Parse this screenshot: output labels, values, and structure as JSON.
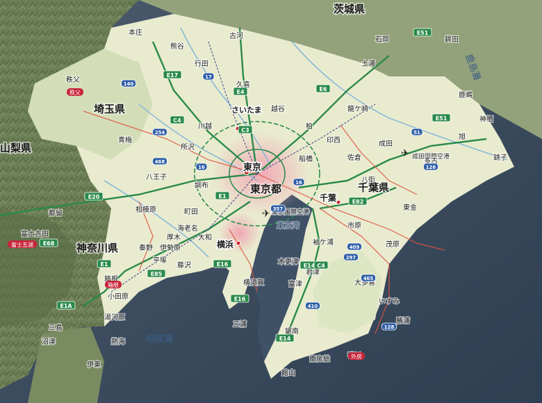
{
  "prefectures": {
    "ibaraki": "茨城県",
    "saitama": "埼玉県",
    "chiba": "千葉県",
    "tokyo": "東京都",
    "kanagawa": "神奈川県",
    "yamanashi": "山梨県"
  },
  "capitals": {
    "tokyo": "東京",
    "saitama": "さいたま",
    "yokohama": "横浜",
    "chiba": "千葉"
  },
  "airports": {
    "narita": "成田国際空港",
    "haneda": "東京国際空港"
  },
  "water_bodies": {
    "sagami_bay": "相模灘",
    "kashima_sea": "鹿島灘",
    "tokyo_bay": "東京湾"
  },
  "cities": [
    {
      "id": "chichibu",
      "text": "秩父"
    },
    {
      "id": "kumagaya",
      "text": "熊谷"
    },
    {
      "id": "kawagoe",
      "text": "川越"
    },
    {
      "id": "hachioji",
      "text": "八王子"
    },
    {
      "id": "sagamihara",
      "text": "相模原"
    },
    {
      "id": "atsugi",
      "text": "厚木"
    },
    {
      "id": "hakone",
      "text": "箱根"
    },
    {
      "id": "odawara",
      "text": "小田原"
    },
    {
      "id": "atami",
      "text": "熱海"
    },
    {
      "id": "yokosuka",
      "text": "横須賀"
    },
    {
      "id": "fujisawa",
      "text": "藤沢"
    },
    {
      "id": "kisarazu",
      "text": "木更津"
    },
    {
      "id": "tateyama",
      "text": "館山"
    },
    {
      "id": "kamogawa",
      "text": "鴨川"
    },
    {
      "id": "mobara",
      "text": "茂原"
    },
    {
      "id": "togane",
      "text": "東金"
    },
    {
      "id": "sakura",
      "text": "佐倉"
    },
    {
      "id": "narita_city",
      "text": "成田"
    },
    {
      "id": "choshi",
      "text": "銚子"
    },
    {
      "id": "kashima",
      "text": "鹿嶋"
    },
    {
      "id": "koga",
      "text": "古河"
    },
    {
      "id": "tsuchiura",
      "text": "土浦"
    },
    {
      "id": "katsuura",
      "text": "勝浦"
    },
    {
      "id": "ome",
      "text": "青梅"
    },
    {
      "id": "machida",
      "text": "町田"
    },
    {
      "id": "yamato",
      "text": "大和"
    },
    {
      "id": "ichihara",
      "text": "市原"
    },
    {
      "id": "futtsu",
      "text": "富津"
    },
    {
      "id": "isumi",
      "text": "いすみ"
    },
    {
      "id": "honjo",
      "text": "本庄"
    },
    {
      "id": "koshigaya",
      "text": "越谷"
    },
    {
      "id": "kashiwa",
      "text": "柏"
    },
    {
      "id": "funabashi",
      "text": "船橋"
    },
    {
      "id": "hiratsuka",
      "text": "平塚"
    },
    {
      "id": "ito",
      "text": "伊東"
    },
    {
      "id": "numazu",
      "text": "沼津"
    },
    {
      "id": "kamisu",
      "text": "神栖"
    },
    {
      "id": "hokota",
      "text": "鉾田"
    },
    {
      "id": "ryugasaki",
      "text": "龍ケ崎"
    },
    {
      "id": "ishioka",
      "text": "石岡"
    },
    {
      "id": "asahi",
      "text": "旭"
    },
    {
      "id": "tako",
      "text": "多古"
    },
    {
      "id": "yachimata",
      "text": "八街"
    },
    {
      "id": "otaki",
      "text": "大多喜"
    },
    {
      "id": "fujiyoshida",
      "text": "富士吉田"
    },
    {
      "id": "tsuru",
      "text": "都留"
    },
    {
      "id": "chofu",
      "text": "調布"
    },
    {
      "id": "tokorozawa",
      "text": "所沢"
    },
    {
      "id": "gyoda",
      "text": "行田"
    },
    {
      "id": "kuki",
      "text": "久喜"
    },
    {
      "id": "misaki",
      "text": "三浦"
    },
    {
      "id": "sodegaura",
      "text": "袖ケ浦"
    },
    {
      "id": "kimitsu",
      "text": "君津"
    },
    {
      "id": "kyonan",
      "text": "鋸南"
    },
    {
      "id": "minamiboso",
      "text": "南房総"
    },
    {
      "id": "inzai",
      "text": "印西"
    },
    {
      "id": "ebina",
      "text": "海老名"
    },
    {
      "id": "isehara",
      "text": "伊勢原"
    },
    {
      "id": "hadano",
      "text": "秦野"
    },
    {
      "id": "yugawara",
      "text": "湯河原"
    },
    {
      "id": "mishima",
      "text": "三島"
    }
  ],
  "expressways": {
    "e1": "E1",
    "e1a": "E1A",
    "e4": "E4",
    "e6": "E6",
    "e14": "E14",
    "e16": "E16",
    "e17": "E17",
    "e20": "E20",
    "e51": "E51",
    "e68": "E68",
    "e82": "E82",
    "e85": "E85",
    "c3": "C3",
    "c4": "C4"
  },
  "routes": [
    "16",
    "17",
    "51",
    "126",
    "128",
    "140",
    "254",
    "297",
    "357",
    "409",
    "410",
    "465",
    "468"
  ],
  "red_tags": {
    "chichibu": "秩父",
    "hakone": "箱根",
    "fuji_five": "富士五湖",
    "sotobo": "外房"
  },
  "colors": {
    "sea": "#3b4e63",
    "lowland": "#eef0d6",
    "plain_green": "#d9e3c3",
    "mountain": "#6c8055",
    "urban": "#f4b9c2",
    "expressway": "#2a8a4a",
    "national_road": "#e0533e",
    "shield_blue": "#2e5ea8",
    "red_tag": "#c8243a"
  },
  "icons": {
    "airport": "airplane-icon",
    "capital": "capital-dot-icon",
    "shrine": "shrine-icon"
  }
}
